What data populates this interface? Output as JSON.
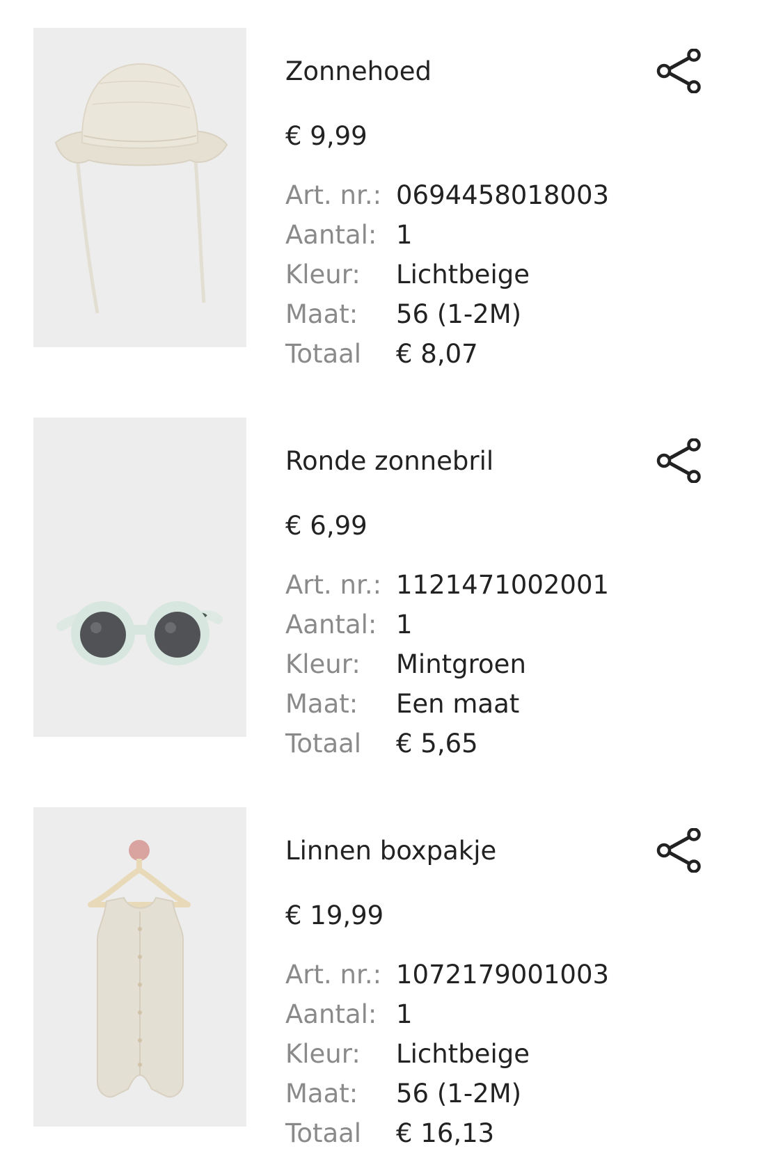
{
  "labels": {
    "article_number": "Art. nr.:",
    "quantity": "Aantal:",
    "color": "Kleur:",
    "size": "Maat:",
    "total": "Totaal"
  },
  "icons": {
    "share": "share-icon"
  },
  "colors": {
    "text_primary": "#222222",
    "text_label": "#8a8a8a",
    "image_background": "#ededed"
  },
  "products": [
    {
      "name": "Zonnehoed",
      "price": "€ 9,99",
      "article_number": "0694458018003",
      "quantity": "1",
      "color": "Lichtbeige",
      "size": "56 (1-2M)",
      "total": "€ 8,07"
    },
    {
      "name": "Ronde zonnebril",
      "price": "€ 6,99",
      "article_number": "1121471002001",
      "quantity": "1",
      "color": "Mintgroen",
      "size": "Een maat",
      "total": "€ 5,65"
    },
    {
      "name": "Linnen boxpakje",
      "price": "€ 19,99",
      "article_number": "1072179001003",
      "quantity": "1",
      "color": "Lichtbeige",
      "size": "56 (1-2M)",
      "total": "€ 16,13"
    }
  ]
}
